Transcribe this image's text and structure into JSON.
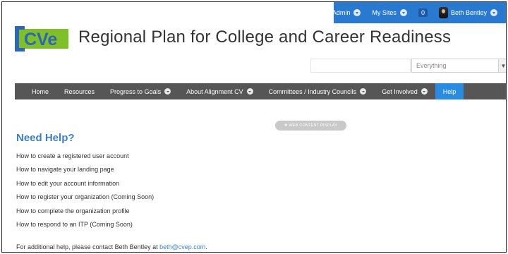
{
  "topbar": {
    "admin_label": "Admin",
    "my_sites_label": "My Sites",
    "notification_count": "0",
    "user_name": "Beth Bentley"
  },
  "header": {
    "logo_text": "CVe",
    "site_title": "Regional Plan for College and Career Readiness"
  },
  "search": {
    "scope_value": "Everything"
  },
  "nav": {
    "items": [
      {
        "label": "Home"
      },
      {
        "label": "Resources"
      },
      {
        "label": "Progress to Goals"
      },
      {
        "label": "About Alignment CV"
      },
      {
        "label": "Committees / Industry Councils"
      },
      {
        "label": "Get Involved"
      },
      {
        "label": "Help"
      }
    ]
  },
  "web_content_display": "WEB CONTENT DISPLAY",
  "help": {
    "heading": "Need Help?",
    "links": [
      "How to create a registered user account",
      "How to navigate your landing page",
      "How to edit your account information",
      "How to register your organization (Coming Soon)",
      "How to complete the organization profile",
      "How to respond to an ITP (Coming Soon)"
    ],
    "footer_text": "For additional help, please contact Beth Bentley at ",
    "footer_email": "beth@cvep.com",
    "footer_end": "."
  },
  "colors": {
    "topbar_blue": "#2a79d0",
    "nav_gray": "#565656",
    "nav_active": "#2a8be0",
    "logo_blue": "#2f66b3",
    "logo_green": "#7fbf2a",
    "heading_blue": "#3d7fc1"
  }
}
